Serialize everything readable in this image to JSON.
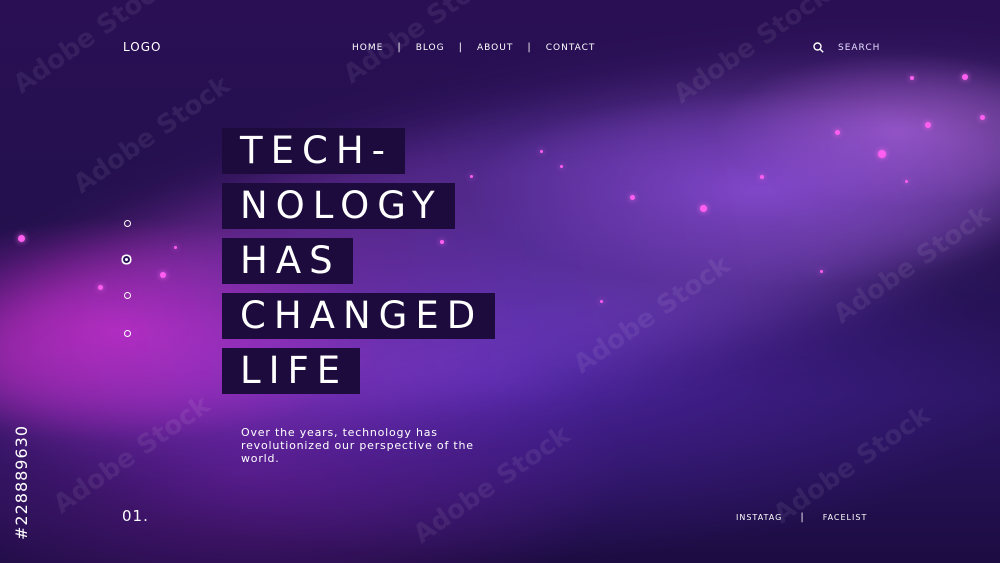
{
  "header": {
    "logo": "LOGO",
    "nav": [
      "HOME",
      "BLOG",
      "ABOUT",
      "CONTACT"
    ],
    "search_placeholder": "SEARCH",
    "search_icon": "search-icon"
  },
  "hero": {
    "headline": [
      "TECH-",
      "NOLOGY",
      "HAS",
      "CHANGED",
      "LIFE"
    ],
    "subtitle": "Over the years, technology has revolutionized our perspective of the world.",
    "slide_number": "01."
  },
  "pagination": {
    "count": 4,
    "active_index": 1
  },
  "footer": {
    "links": [
      "INSTATAG",
      "FACELIST"
    ]
  },
  "watermark": {
    "text": "Adobe Stock",
    "id": "#228889630"
  },
  "colors": {
    "background": "#23104d",
    "accent_magenta": "#ff5ef0",
    "headline_box": "#1c0b3c"
  }
}
